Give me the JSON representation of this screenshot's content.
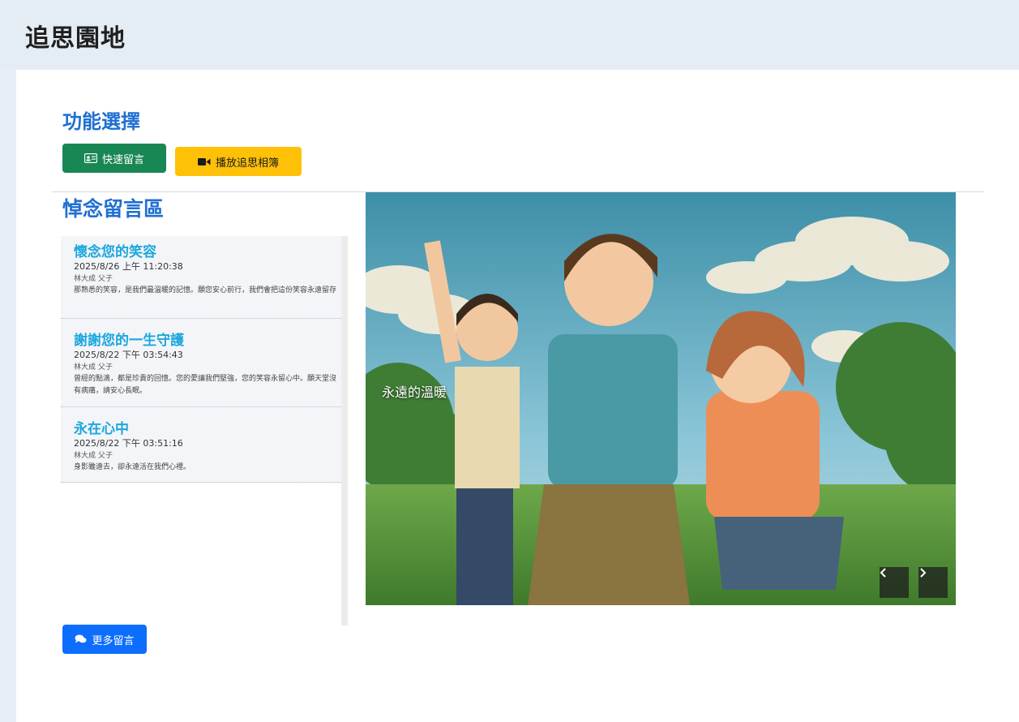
{
  "header": {
    "title": "追思園地"
  },
  "functions": {
    "title": "功能選擇",
    "quick_message_label": "快速留言",
    "play_album_label": "播放追思相簿"
  },
  "memorial": {
    "title": "悼念留言區",
    "messages": [
      {
        "title": "懷念您的笑容",
        "date": "2025/8/26 上午 11:20:38",
        "author": "林大成 父子",
        "body": "那熟悉的笑容，是我們最溫暖的記憶。願您安心前行，我們會把這份笑容永遠留存"
      },
      {
        "title": "謝謝您的一生守護",
        "date": "2025/8/22 下午 03:54:43",
        "author": "林大成 父子",
        "body": "曾經的點滴，都是珍貴的回憶。您的愛讓我們堅強，您的笑容永留心中。願天堂沒有病痛，請安心長眠。"
      },
      {
        "title": "永在心中",
        "date": "2025/8/22 下午 03:51:16",
        "author": "林大成 父子",
        "body": "身影雖遠去，卻永遠活在我們心裡。"
      }
    ],
    "more_label": "更多留言"
  },
  "carousel": {
    "caption": "永遠的溫暖",
    "prev_icon": "chevron-left-icon",
    "next_icon": "chevron-right-icon"
  }
}
